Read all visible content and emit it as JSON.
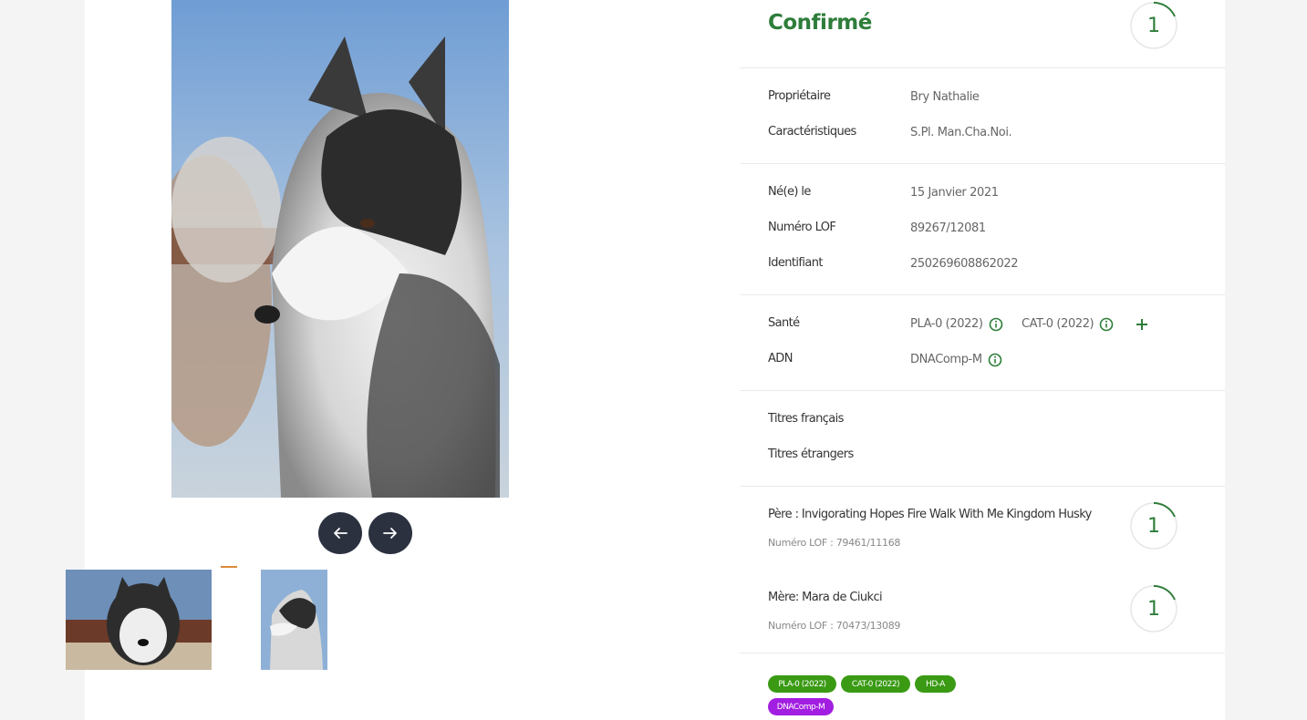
{
  "gallery": {
    "prev_label": "Précédent",
    "next_label": "Suivant"
  },
  "status": {
    "title": "Confirmé",
    "badge_count": "1"
  },
  "details": {
    "owner": {
      "label": "Propriétaire",
      "value": "Bry Nathalie"
    },
    "features": {
      "label": "Caractéristiques",
      "value": "S.Pl. Man.Cha.Noi."
    },
    "birth": {
      "label": "Né(e) le",
      "value": "15 Janvier 2021"
    },
    "lof": {
      "label": "Numéro LOF",
      "value": "89267/12081"
    },
    "identifier": {
      "label": "Identifiant",
      "value": "250269608862022"
    }
  },
  "health": {
    "label": "Santé",
    "items": [
      "PLA-0 (2022)",
      "CAT-0 (2022)"
    ],
    "icon": "info-icon",
    "add_icon": "plus-icon"
  },
  "dna": {
    "label": "ADN",
    "value": "DNAComp-M"
  },
  "titles": {
    "french": "Titres français",
    "foreign": "Titres étrangers"
  },
  "father": {
    "name": "Père : Invigorating Hopes Fire Walk With Me Kingdom Husky",
    "lof": "Numéro LOF : 79461/11168",
    "badge_count": "1"
  },
  "mother": {
    "name": "Mère: Mara de Ciukci",
    "lof": "Numéro LOF : 70473/13089",
    "badge_count": "1"
  },
  "tags": [
    "PLA-0 (2022)",
    "CAT-0 (2022)",
    "HD-A",
    "DNAComp-M"
  ],
  "colors": {
    "accent_green": "#2e7d3a",
    "tag_green": "#3a9a14",
    "tag_purple": "#a21ee0",
    "nav_button": "#2c3140",
    "thumb_marker": "#d98a3a"
  }
}
